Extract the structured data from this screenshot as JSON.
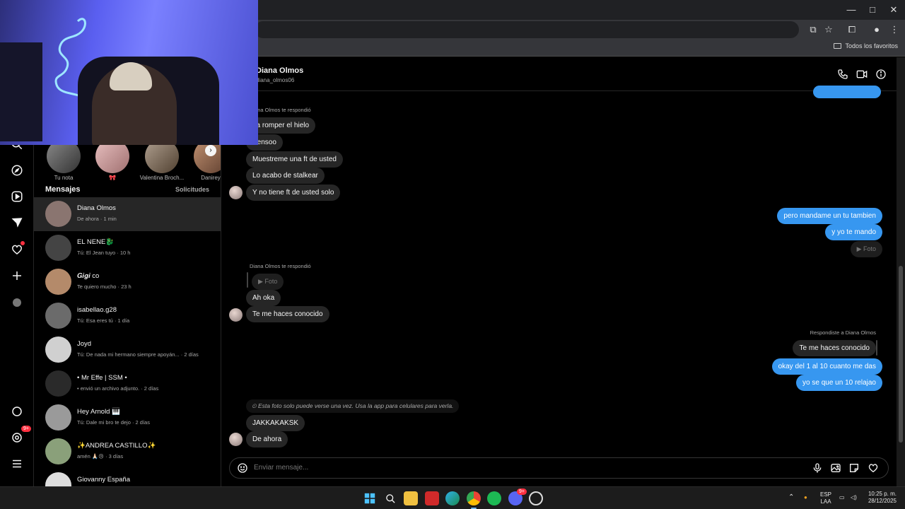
{
  "browser": {
    "bookmarks_folder": "Todos los favoritos",
    "window_controls": [
      "—",
      "□",
      "✕"
    ]
  },
  "nav_rail": {
    "icons": [
      "search-icon",
      "explore-icon",
      "reels-icon",
      "messages-icon",
      "notifications-icon",
      "create-icon",
      "profile-icon",
      "threads-icon",
      "activity-icon",
      "menu-icon"
    ],
    "activity_badge": "9+"
  },
  "notes": [
    {
      "label": "Tu nota"
    },
    {
      "label": "🎀"
    },
    {
      "label": "Valentina Broch..."
    },
    {
      "label": "Danirey"
    }
  ],
  "convos": {
    "heading": "Mensajes",
    "requests": "Solicitudes",
    "threads": [
      {
        "name": "Diana Olmos",
        "sub": "De ahora · 1 min",
        "color": "#8a7570"
      },
      {
        "name": "EL NENE🐉",
        "sub": "Tú: El Jean tuyo · 10 h",
        "color": "#444"
      },
      {
        "name": "𝑮𝒊𝒈𝒊 co",
        "sub": "Te quiero mucho · 23 h",
        "color": "#b48a6a"
      },
      {
        "name": "isabellao.g28",
        "sub": "Tú: Esa eres tú · 1 día",
        "color": "#6b6b6b"
      },
      {
        "name": "Joyd",
        "sub": "Tú: De nada mi hermano siempre apoyán... · 2 días",
        "color": "#d0d0d0"
      },
      {
        "name": "• Mr Effe | SSM •",
        "sub": "• envió un archivo adjunto. · 2 días",
        "color": "#2a2a2a"
      },
      {
        "name": "Hey Arnold 🎹",
        "sub": "Tú: Dale mi bro te dejo · 2 días",
        "color": "#9a9a9a"
      },
      {
        "name": "✨ANDREA CASTILLO✨",
        "sub": "amén 🙏🏻😢 · 3 días",
        "color": "#8aa07a"
      },
      {
        "name": "Giovanny España",
        "sub": "",
        "color": "#dddddd"
      }
    ]
  },
  "chat": {
    "name": "Diana Olmos",
    "username": "diana_olmos06",
    "reply_meta_1": "Diana Olmos te respondió",
    "messages_a": [
      "pa romper el hielo",
      "Pensoo",
      "Muestreme una ft de usted",
      "Lo acabo de stalkear",
      "Y no tiene ft de usted solo"
    ],
    "out_a": [
      "pero mandame un tu tambien",
      "y yo te mando"
    ],
    "photo_label": "Foto",
    "reply_meta_2": "Diana Olmos te respondió",
    "messages_b": [
      "Ah oka",
      "Te me haces conocido"
    ],
    "reply_meta_3": "Respondiste a Diana Olmos",
    "quoted": "Te me haces conocido",
    "out_b": [
      "okay del 1 al 10 cuanto me das",
      "yo se que un 10 relajao"
    ],
    "notice": "Esta foto solo puede verse una vez. Usa la app para celulares para verla.",
    "messages_c": [
      "JAKKAKAKSK",
      "De ahora"
    ],
    "composer_placeholder": "Enviar mensaje..."
  },
  "taskbar": {
    "lang_1": "ESP",
    "lang_2": "LAA",
    "time": "10:25 p. m.",
    "date": "28/12/2025",
    "discord_badge": "9+"
  },
  "colors": {
    "outgoing": "#3797f0",
    "incoming": "#262626",
    "background": "#000000"
  }
}
